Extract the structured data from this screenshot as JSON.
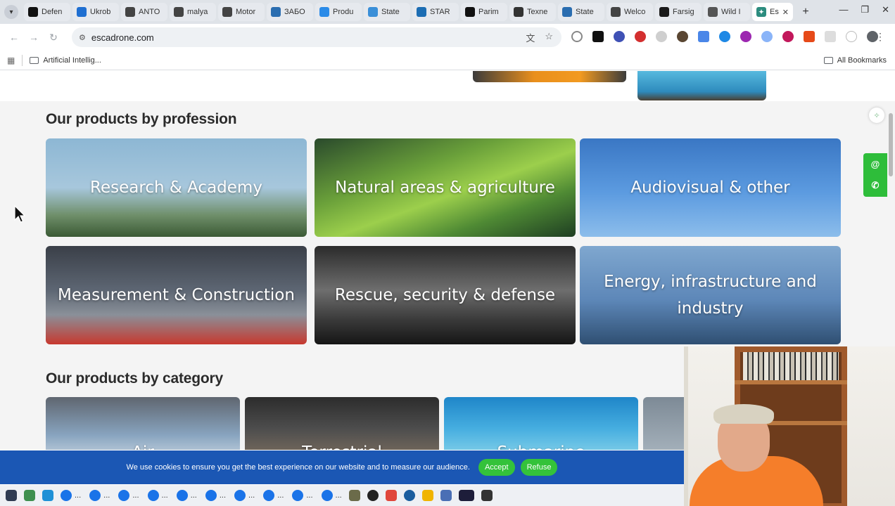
{
  "browser": {
    "tabs": [
      {
        "label": "Defen",
        "icon": "x-icon",
        "color": "#111111"
      },
      {
        "label": "Ukrob",
        "icon": "u-icon",
        "color": "#1f6fd1"
      },
      {
        "label": "ANTO",
        "icon": "globe-icon",
        "color": "#444444"
      },
      {
        "label": "malya",
        "icon": "globe-icon",
        "color": "#444444"
      },
      {
        "label": "Motor",
        "icon": "globe-icon",
        "color": "#444444"
      },
      {
        "label": "ЗАБО",
        "icon": "wordpress-icon",
        "color": "#2a6db0"
      },
      {
        "label": "Produ",
        "icon": "blue-icon",
        "color": "#2a8be8"
      },
      {
        "label": "State",
        "icon": "drop-icon",
        "color": "#3a8fd8"
      },
      {
        "label": "STAR",
        "icon": "globe-icon",
        "color": "#1c6db3"
      },
      {
        "label": "Parim",
        "icon": "dark-icon",
        "color": "#111111"
      },
      {
        "label": "Texne",
        "icon": "cross-icon",
        "color": "#333333"
      },
      {
        "label": "State",
        "icon": "wordpress-icon",
        "color": "#2a6db0"
      },
      {
        "label": "Welco",
        "icon": "globe-icon",
        "color": "#444444"
      },
      {
        "label": "Farsig",
        "icon": "dark-icon",
        "color": "#1a1a1a"
      },
      {
        "label": "Wild I",
        "icon": "gear-icon",
        "color": "#555555"
      }
    ],
    "active_tab": {
      "label": "Es",
      "close": "✕"
    },
    "new_tab": "+",
    "window_controls": {
      "minimize": "—",
      "maximize": "❐",
      "close": "✕"
    },
    "url": "escadrone.com",
    "bookmarks": {
      "folder": "Artificial Intellig...",
      "all": "All Bookmarks"
    }
  },
  "page": {
    "profession_title": "Our products by profession",
    "profession_cards": [
      {
        "label": "Research & Academy",
        "bg": "linear-gradient(180deg,#8db7d4 0%,#a7c7dc 50%,#6f8f6a 78%,#3b5a35 100%)"
      },
      {
        "label": "Natural areas & agriculture",
        "bg": "linear-gradient(160deg,#2a4a2c 0%,#6aa03a 35%,#9ccf4c 55%,#4f8a34 75%,#1e3e22 100%)"
      },
      {
        "label": "Audiovisual & other",
        "bg": "linear-gradient(180deg,#3a77c4 0%,#5c9be0 55%,#8cbdeb 100%)"
      },
      {
        "label": "Measurement & Construction",
        "bg": "linear-gradient(180deg,#3a3f48 0%,#5d6673 45%,#8a9099 70%,#c7382e 100%)"
      },
      {
        "label": "Rescue, security & defense",
        "bg": "linear-gradient(180deg,#2b2b2b 0%,#6e6e6e 45%,#3a3a3a 75%,#151515 100%)"
      },
      {
        "label": "Energy, infrastructure and industry",
        "bg": "linear-gradient(180deg,#7fa7cf 0%,#5d87b8 55%,#2f4f72 100%)"
      }
    ],
    "category_title": "Our products by category",
    "category_cards": [
      {
        "label": "Air",
        "bg": "linear-gradient(180deg,#5f6670 0%,#88a4bf 60%,#c7d5e2 100%)"
      },
      {
        "label": "Terrestrial",
        "bg": "linear-gradient(180deg,#2c2c2c 0%,#4d4d4d 50%,#7d6f60 100%)"
      },
      {
        "label": "Submarine",
        "bg": "linear-gradient(180deg,#1f86c9 0%,#46aee0 50%,#8cd5ea 100%)"
      },
      {
        "label": "",
        "bg": "linear-gradient(180deg,#7d8a96 0%,#aab6c0 100%)"
      }
    ],
    "cookie": {
      "text": "We use cookies to ensure you get the best experience on our website and to measure our audience.",
      "accept": "Accept",
      "refuse": "Refuse"
    },
    "side_widget": {
      "email": "@",
      "phone": "✆"
    }
  },
  "taskbar": {
    "items": [
      {
        "label": "...",
        "color": "#1a73e8"
      },
      {
        "label": "...",
        "color": "#1a73e8"
      },
      {
        "label": "...",
        "color": "#1a73e8"
      },
      {
        "label": "...",
        "color": "#1a73e8"
      },
      {
        "label": "...",
        "color": "#1a73e8"
      },
      {
        "label": "...",
        "color": "#1a73e8"
      },
      {
        "label": "...",
        "color": "#1a73e8"
      },
      {
        "label": "...",
        "color": "#1a73e8"
      },
      {
        "label": "...",
        "color": "#1a73e8"
      },
      {
        "label": "...",
        "color": "#1a73e8"
      }
    ]
  }
}
